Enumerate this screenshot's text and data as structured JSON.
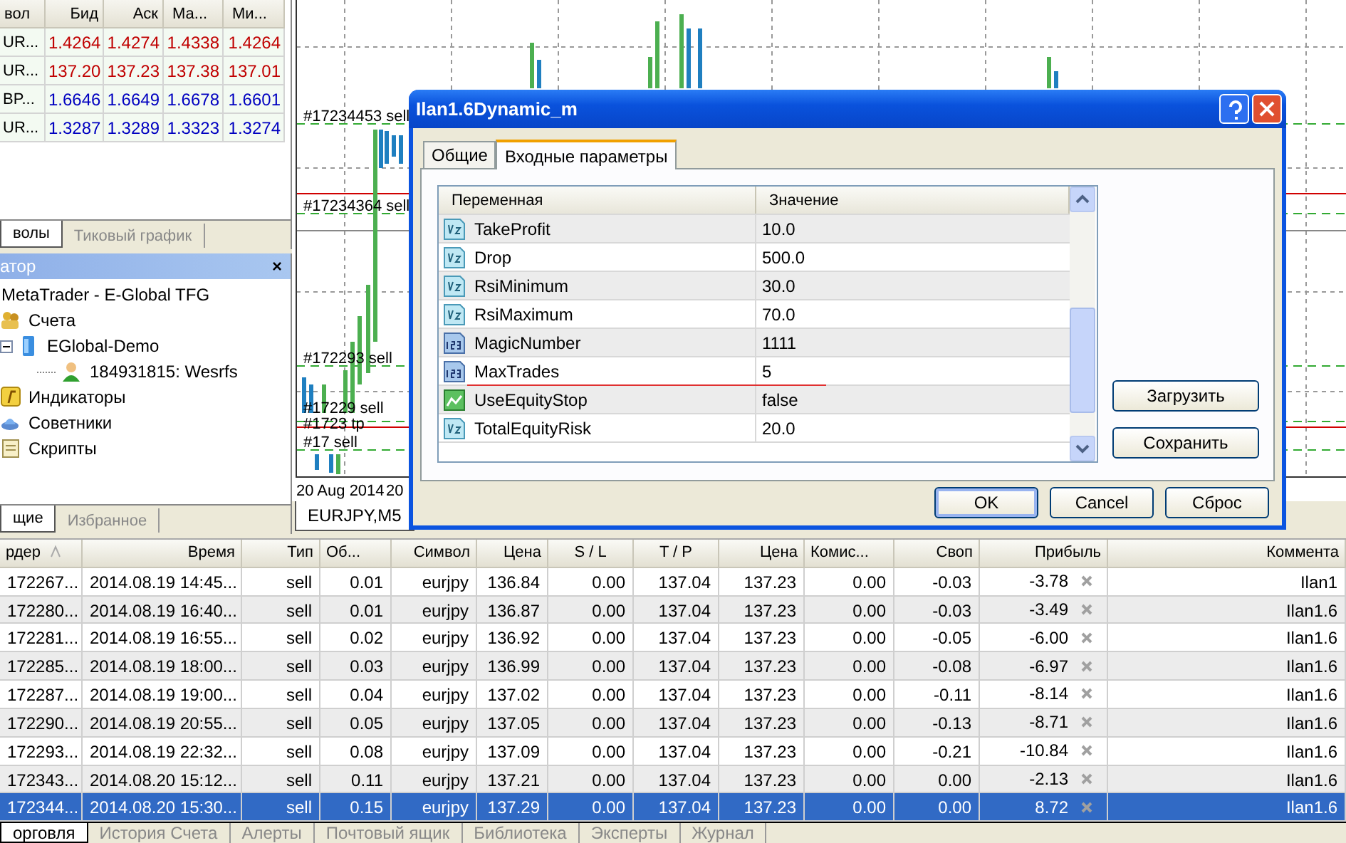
{
  "market_watch": {
    "columns": [
      "вол",
      "Бид",
      "Аск",
      "Ма...",
      "Ми..."
    ],
    "rows": [
      {
        "symbol": "UR...",
        "color": "#c00000",
        "bid": "1.4264",
        "ask": "1.4274",
        "high": "1.4338",
        "low": "1.4264"
      },
      {
        "symbol": "UR...",
        "color": "#c00000",
        "bid": "137.20",
        "ask": "137.23",
        "high": "137.38",
        "low": "137.01"
      },
      {
        "symbol": "BP...",
        "color": "#0000c0",
        "bid": "1.6646",
        "ask": "1.6649",
        "high": "1.6678",
        "low": "1.6601"
      },
      {
        "symbol": "UR...",
        "color": "#0000c0",
        "bid": "1.3287",
        "ask": "1.3289",
        "high": "1.3323",
        "low": "1.3274"
      }
    ],
    "tabs": [
      {
        "label": "волы",
        "selected": true
      },
      {
        "label": "Тиковый график",
        "selected": false
      }
    ]
  },
  "navigator": {
    "title": "атор",
    "close": "×",
    "tree": [
      {
        "label": "MetaTrader - E-Global TFG",
        "children": [
          {
            "label": "Счета",
            "kind": "accounts",
            "children": [
              {
                "label": "EGlobal-Demo",
                "kind": "server",
                "expanded": true,
                "children": [
                  {
                    "label": "184931815: Wesrfs",
                    "kind": "account"
                  }
                ]
              }
            ]
          },
          {
            "label": "Индикаторы",
            "kind": "indicators"
          },
          {
            "label": "Советники",
            "kind": "experts"
          },
          {
            "label": "Скрипты",
            "kind": "scripts"
          }
        ]
      }
    ],
    "tabs": [
      {
        "label": "щие",
        "selected": true
      },
      {
        "label": "Избранное",
        "selected": false
      }
    ]
  },
  "chart": {
    "order_labels": [
      {
        "id": "#17234453",
        "side": "sell"
      },
      {
        "id": "#17234364",
        "side": "sell"
      },
      {
        "id": "#172293",
        "side": "sell"
      },
      {
        "id": "#17229",
        "side": "sell"
      },
      {
        "id": "#1723",
        "side": "tp"
      },
      {
        "id": "#17",
        "side": "sell"
      }
    ],
    "axis_labels": [
      "20 Aug 2014",
      "20"
    ],
    "tab": "EURJPY,M5"
  },
  "dialog": {
    "title": "Ilan1.6Dynamic_m",
    "tabs": [
      {
        "label": "Общие",
        "selected": false
      },
      {
        "label": "Входные параметры",
        "selected": true
      }
    ],
    "params": {
      "columns": [
        "Переменная",
        "Значение"
      ],
      "rows": [
        {
          "name": "TakeProfit",
          "value": "10.0",
          "kind": "double",
          "marked": false
        },
        {
          "name": "Drop",
          "value": "500.0",
          "kind": "double",
          "marked": false
        },
        {
          "name": "RsiMinimum",
          "value": "30.0",
          "kind": "double",
          "marked": false
        },
        {
          "name": "RsiMaximum",
          "value": "70.0",
          "kind": "double",
          "marked": false
        },
        {
          "name": "MagicNumber",
          "value": "1111",
          "kind": "int",
          "marked": false
        },
        {
          "name": "MaxTrades",
          "value": "5",
          "kind": "int",
          "marked": true
        },
        {
          "name": "UseEquityStop",
          "value": "false",
          "kind": "bool",
          "marked": false
        },
        {
          "name": "TotalEquityRisk",
          "value": "20.0",
          "kind": "double",
          "marked": false
        }
      ]
    },
    "side_buttons": [
      "Загрузить",
      "Сохранить"
    ],
    "buttons": [
      {
        "label": "OK",
        "default": true
      },
      {
        "label": "Cancel",
        "default": false
      },
      {
        "label": "Сброс",
        "default": false
      }
    ]
  },
  "terminal": {
    "columns": [
      {
        "label": "рдер",
        "sorted": true
      },
      {
        "label": "Время",
        "sorted": false
      },
      {
        "label": "Тип",
        "sorted": false
      },
      {
        "label": "Об...",
        "sorted": false
      },
      {
        "label": "Символ",
        "sorted": false
      },
      {
        "label": "Цена",
        "sorted": false
      },
      {
        "label": "S / L",
        "sorted": false
      },
      {
        "label": "T / P",
        "sorted": false
      },
      {
        "label": "Цена",
        "sorted": false
      },
      {
        "label": "Комис...",
        "sorted": false
      },
      {
        "label": "Своп",
        "sorted": false
      },
      {
        "label": "Прибыль",
        "sorted": false
      },
      {
        "label": "Коммента",
        "sorted": false
      }
    ],
    "rows": [
      {
        "cells": [
          "172267...",
          "2014.08.19 14:45...",
          "sell",
          "0.01",
          "eurjpy",
          "136.84",
          "0.00",
          "137.04",
          "137.23",
          "0.00",
          "-0.03",
          "-3.78",
          "Ilan1"
        ],
        "selected": false
      },
      {
        "cells": [
          "172280...",
          "2014.08.19 16:40...",
          "sell",
          "0.01",
          "eurjpy",
          "136.87",
          "0.00",
          "137.04",
          "137.23",
          "0.00",
          "-0.03",
          "-3.49",
          "Ilan1.6"
        ],
        "selected": false
      },
      {
        "cells": [
          "172281...",
          "2014.08.19 16:55...",
          "sell",
          "0.02",
          "eurjpy",
          "136.92",
          "0.00",
          "137.04",
          "137.23",
          "0.00",
          "-0.05",
          "-6.00",
          "Ilan1.6"
        ],
        "selected": false
      },
      {
        "cells": [
          "172285...",
          "2014.08.19 18:00...",
          "sell",
          "0.03",
          "eurjpy",
          "136.99",
          "0.00",
          "137.04",
          "137.23",
          "0.00",
          "-0.08",
          "-6.97",
          "Ilan1.6"
        ],
        "selected": false
      },
      {
        "cells": [
          "172287...",
          "2014.08.19 19:00...",
          "sell",
          "0.04",
          "eurjpy",
          "137.02",
          "0.00",
          "137.04",
          "137.23",
          "0.00",
          "-0.11",
          "-8.14",
          "Ilan1.6"
        ],
        "selected": false
      },
      {
        "cells": [
          "172290...",
          "2014.08.19 20:55...",
          "sell",
          "0.05",
          "eurjpy",
          "137.05",
          "0.00",
          "137.04",
          "137.23",
          "0.00",
          "-0.13",
          "-8.71",
          "Ilan1.6"
        ],
        "selected": false
      },
      {
        "cells": [
          "172293...",
          "2014.08.19 22:32...",
          "sell",
          "0.08",
          "eurjpy",
          "137.09",
          "0.00",
          "137.04",
          "137.23",
          "0.00",
          "-0.21",
          "-10.84",
          "Ilan1.6"
        ],
        "selected": false
      },
      {
        "cells": [
          "172343...",
          "2014.08.20 15:12...",
          "sell",
          "0.11",
          "eurjpy",
          "137.21",
          "0.00",
          "137.04",
          "137.23",
          "0.00",
          "0.00",
          "-2.13",
          "Ilan1.6"
        ],
        "selected": false
      },
      {
        "cells": [
          "172344...",
          "2014.08.20 15:30...",
          "sell",
          "0.15",
          "eurjpy",
          "137.29",
          "0.00",
          "137.04",
          "137.23",
          "0.00",
          "0.00",
          "8.72",
          "Ilan1.6"
        ],
        "selected": true
      }
    ],
    "tabs": [
      {
        "label": "орговля",
        "selected": true
      },
      {
        "label": "История Счета",
        "selected": false
      },
      {
        "label": "Алерты",
        "selected": false
      },
      {
        "label": "Почтовый ящик",
        "selected": false
      },
      {
        "label": "Библиотека",
        "selected": false
      },
      {
        "label": "Эксперты",
        "selected": false
      },
      {
        "label": "Журнал",
        "selected": false
      }
    ]
  }
}
